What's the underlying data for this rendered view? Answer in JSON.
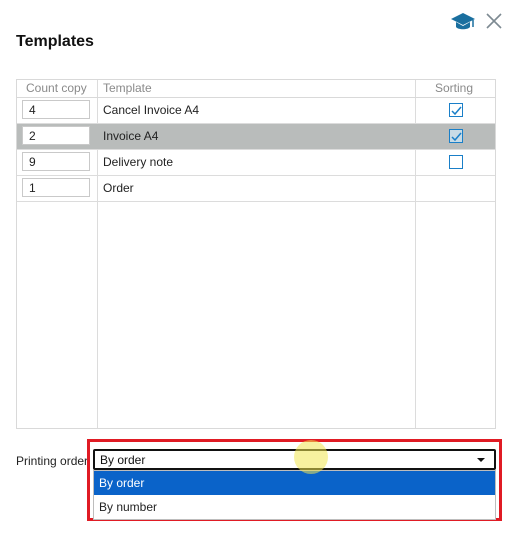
{
  "dialog": {
    "title": "Templates",
    "help_icon": "graduation-cap-icon",
    "close_icon": "close-icon",
    "accent_color": "#1a7fc8"
  },
  "table": {
    "columns": {
      "count": "Count copy",
      "template": "Template",
      "sorting": "Sorting"
    },
    "rows": [
      {
        "count": "4",
        "template": "Cancel Invoice A4",
        "sorting": true
      },
      {
        "count": "2",
        "template": "Invoice A4",
        "sorting": true,
        "selected": true
      },
      {
        "count": "9",
        "template": "Delivery note",
        "sorting": false
      },
      {
        "count": "1",
        "template": "Order",
        "sorting": null
      }
    ]
  },
  "printing_order": {
    "label": "Printing order",
    "value": "By order",
    "options": [
      "By order",
      "By number"
    ],
    "highlight_color": "#e01b24",
    "selected_option_color": "#0a63c9"
  }
}
